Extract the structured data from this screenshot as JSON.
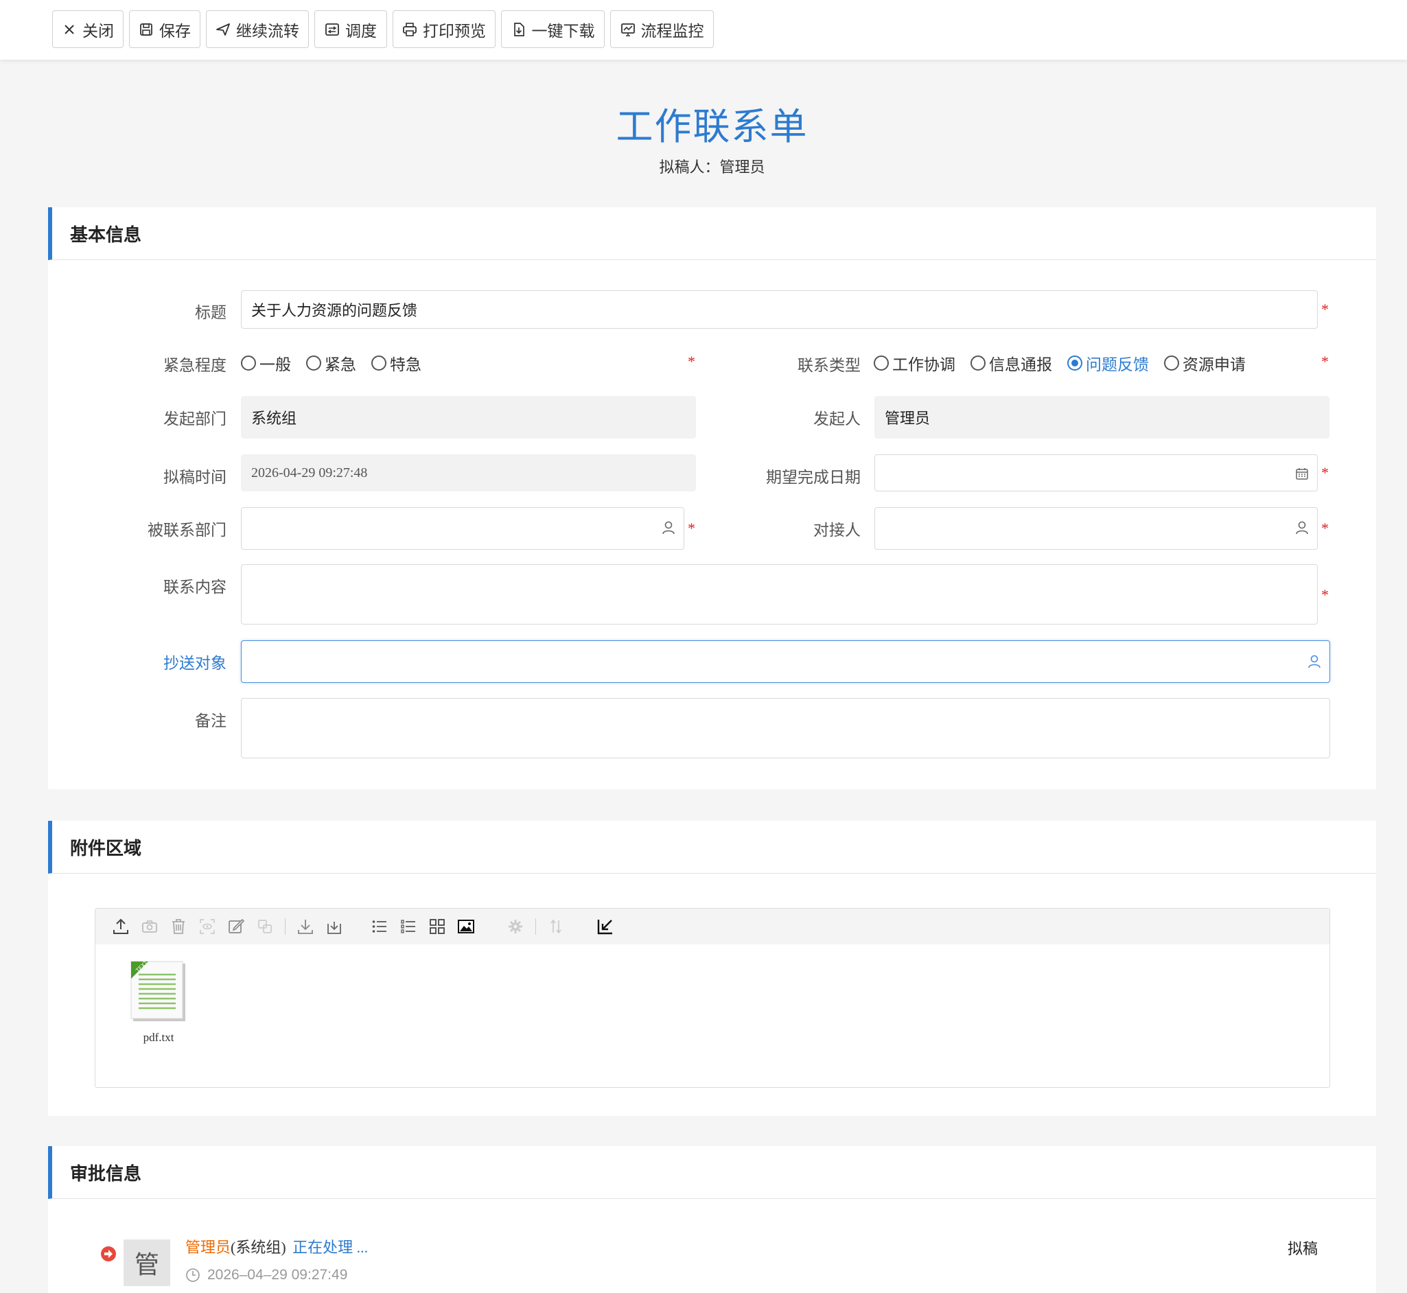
{
  "toolbar": {
    "close": "关闭",
    "save": "保存",
    "continue": "继续流转",
    "dispatch": "调度",
    "print": "打印预览",
    "download": "一键下载",
    "monitor": "流程监控"
  },
  "header": {
    "title": "工作联系单",
    "drafter": "拟稿人：管理员"
  },
  "basic": {
    "section_title": "基本信息",
    "title_label": "标题",
    "title_value": "关于人力资源的问题反馈",
    "urgency_label": "紧急程度",
    "urgency_options": [
      "一般",
      "紧急",
      "特急"
    ],
    "contact_type_label": "联系类型",
    "contact_type_options": [
      "工作协调",
      "信息通报",
      "问题反馈",
      "资源申请"
    ],
    "contact_type_selected": "问题反馈",
    "dept_label": "发起部门",
    "dept_value": "系统组",
    "initiator_label": "发起人",
    "initiator_value": "管理员",
    "draft_time_label": "拟稿时间",
    "draft_time_value": "2026-04-29 09:27:48",
    "expect_date_label": "期望完成日期",
    "target_dept_label": "被联系部门",
    "contact_person_label": "对接人",
    "content_label": "联系内容",
    "cc_label": "抄送对象",
    "remark_label": "备注",
    "required_mark": "*"
  },
  "attachments": {
    "section_title": "附件区域",
    "files": [
      {
        "name": "pdf.txt",
        "badge": "TEXT"
      }
    ]
  },
  "approval": {
    "section_title": "审批信息",
    "entries": [
      {
        "avatar": "管",
        "user": "管理员",
        "dept": "(系统组)",
        "status": "正在处理 ...",
        "time": "2026–04–29 09:27:49",
        "step": "拟稿"
      }
    ]
  },
  "colors": {
    "accent": "#2d7bd0",
    "required": "#e02020",
    "user_name": "#f06a00"
  }
}
